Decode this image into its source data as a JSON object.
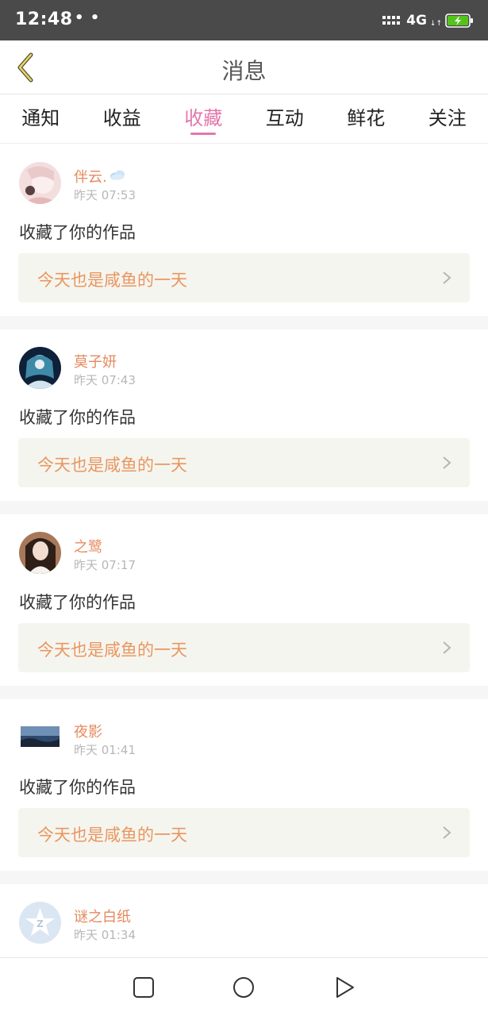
{
  "status_bar": {
    "time": "12:48",
    "dots": "• •",
    "network": "4G",
    "network_arrows": "↓↑"
  },
  "header": {
    "title": "消息",
    "back_icon": "back-chevron-icon"
  },
  "tabs": [
    {
      "label": "通知",
      "active": false
    },
    {
      "label": "收益",
      "active": false
    },
    {
      "label": "收藏",
      "active": true
    },
    {
      "label": "互动",
      "active": false
    },
    {
      "label": "鲜花",
      "active": false
    },
    {
      "label": "关注",
      "active": false
    }
  ],
  "messages": [
    {
      "user": "伴云.",
      "time": "昨天 07:53",
      "action": "收藏了你的作品",
      "work": "今天也是咸鱼的一天"
    },
    {
      "user": "莫子妍",
      "time": "昨天 07:43",
      "action": "收藏了你的作品",
      "work": "今天也是咸鱼的一天"
    },
    {
      "user": "之鹭",
      "time": "昨天 07:17",
      "action": "收藏了你的作品",
      "work": "今天也是咸鱼的一天"
    },
    {
      "user": "夜影",
      "time": "昨天 01:41",
      "action": "收藏了你的作品",
      "work": "今天也是咸鱼的一天"
    },
    {
      "user": "谜之白纸",
      "time": "昨天 01:34"
    }
  ],
  "colors": {
    "accent_pink": "#e377ac",
    "name_orange": "#e58a5e",
    "work_orange": "#e9965f",
    "status_bar": "#4a4a4a"
  }
}
